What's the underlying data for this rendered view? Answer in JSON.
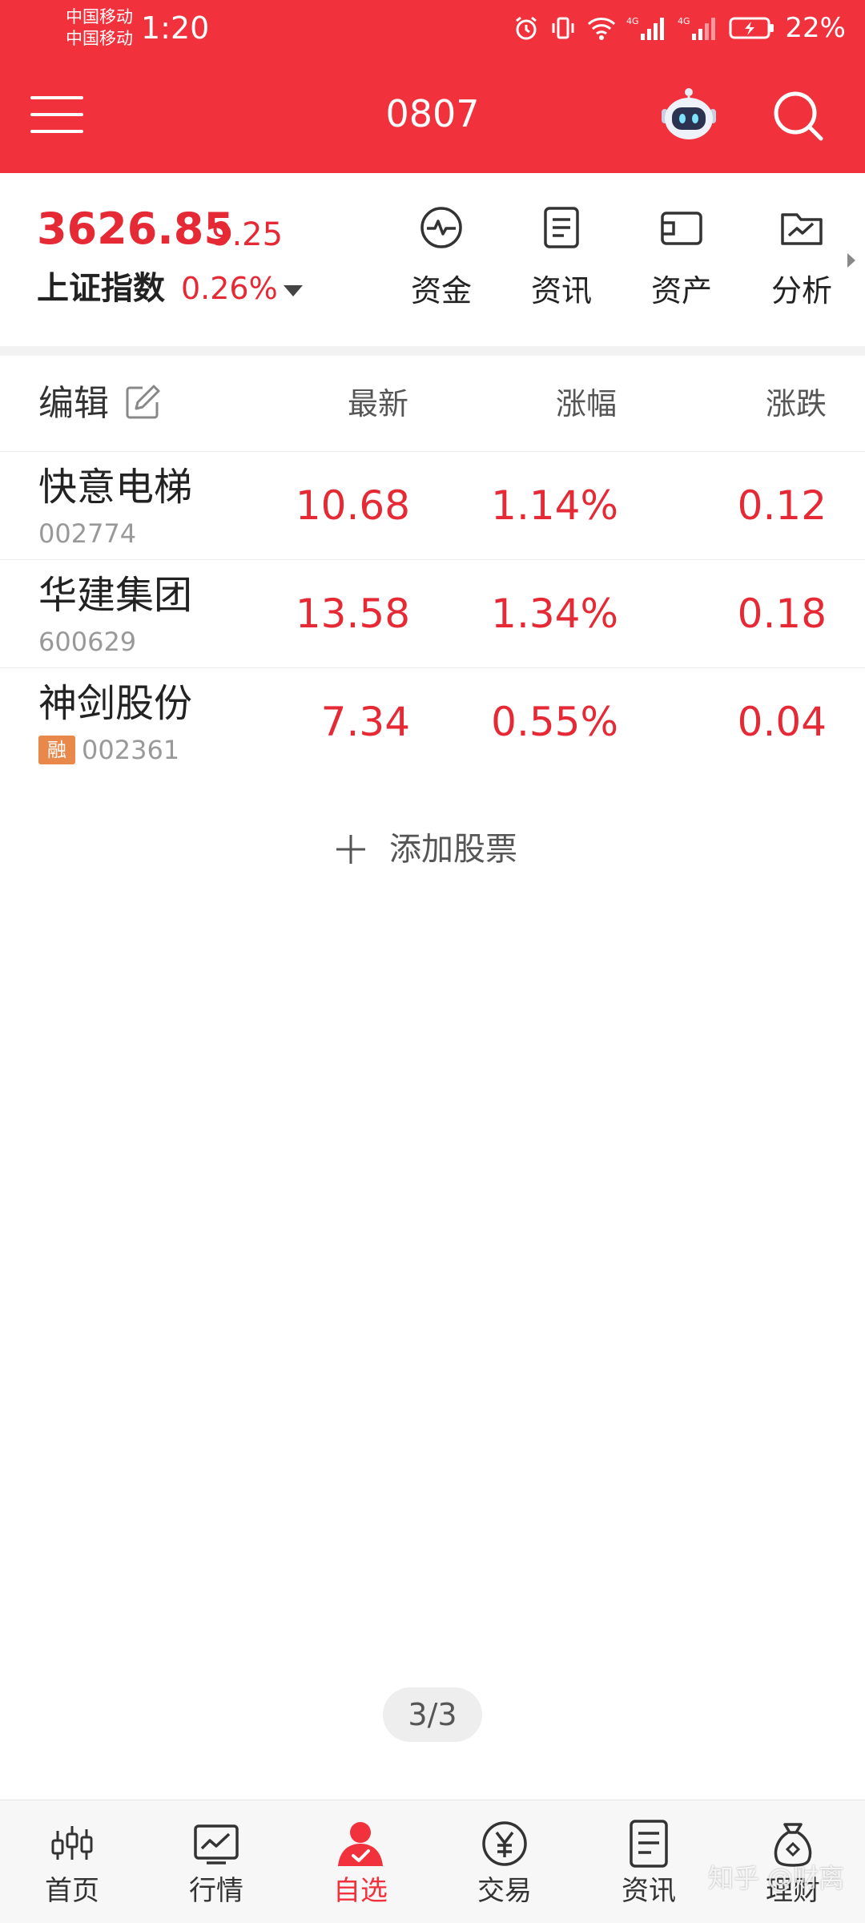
{
  "status_bar": {
    "carrier_1": "中国移动",
    "carrier_2": "中国移动",
    "time": "1:20",
    "battery": "22%",
    "icons": [
      "alarm-icon",
      "vibrate-icon",
      "wifi-icon",
      "signal-4g-icon",
      "signal-4g-icon",
      "battery-charging-icon"
    ]
  },
  "header": {
    "title": "0807",
    "bg_color": "#f1313c",
    "icons": [
      "menu-icon",
      "robot-assistant-icon",
      "search-icon"
    ]
  },
  "index_summary": {
    "value": "3626.85",
    "change": "9.25",
    "name": "上证指数",
    "percent": "0.26%",
    "quick_actions": [
      {
        "label": "资金",
        "icon": "pulse-icon"
      },
      {
        "label": "资讯",
        "icon": "document-icon"
      },
      {
        "label": "资产",
        "icon": "wallet-icon"
      },
      {
        "label": "分析",
        "icon": "chart-folder-icon"
      }
    ]
  },
  "watchlist": {
    "edit_label": "编辑",
    "columns": [
      "最新",
      "涨幅",
      "涨跌"
    ],
    "rows": [
      {
        "name": "快意电梯",
        "code": "002774",
        "badge": "",
        "latest": "10.68",
        "pct": "1.14%",
        "change": "0.12"
      },
      {
        "name": "华建集团",
        "code": "600629",
        "badge": "",
        "latest": "13.58",
        "pct": "1.34%",
        "change": "0.18"
      },
      {
        "name": "神剑股份",
        "code": "002361",
        "badge": "融",
        "latest": "7.34",
        "pct": "0.55%",
        "change": "0.04"
      }
    ],
    "add_label": "添加股票",
    "up_color": "#e52a35"
  },
  "pager": "3/3",
  "tabbar": {
    "active_index": 2,
    "tabs": [
      {
        "label": "首页",
        "icon": "candlestick-icon"
      },
      {
        "label": "行情",
        "icon": "trend-chart-icon"
      },
      {
        "label": "自选",
        "icon": "user-check-icon"
      },
      {
        "label": "交易",
        "icon": "yuan-icon"
      },
      {
        "label": "资讯",
        "icon": "document-icon"
      },
      {
        "label": "理财",
        "icon": "money-bag-icon"
      }
    ]
  },
  "watermark": "知乎 @财离"
}
